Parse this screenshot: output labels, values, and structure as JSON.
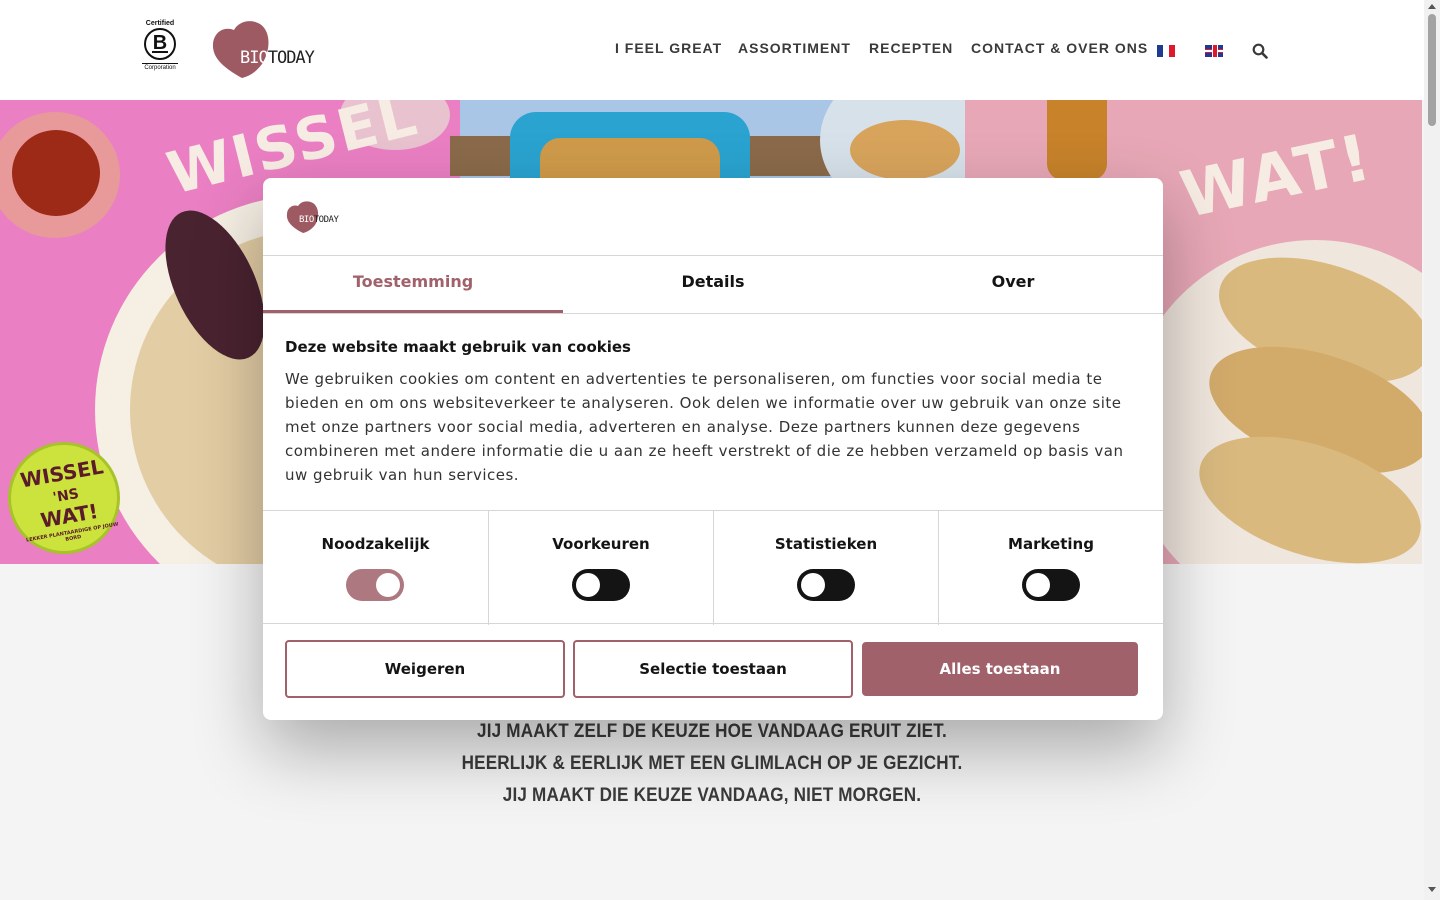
{
  "header": {
    "certified_logo": {
      "top": "Certified",
      "letter": "B",
      "bottom": "Corporation"
    },
    "brand_logo": {
      "part1": "BIO",
      "part2": "TODAY"
    },
    "nav": [
      {
        "label": "I FEEL GREAT"
      },
      {
        "label": "ASSORTIMENT"
      },
      {
        "label": "RECEPTEN"
      },
      {
        "label": "CONTACT & OVER ONS"
      }
    ],
    "languages": [
      {
        "name": "flag-fr-icon"
      },
      {
        "name": "flag-uk-icon"
      }
    ],
    "search_icon": "search-icon"
  },
  "hero": {
    "left_word": "WISSEL",
    "right_word": "WAT!",
    "badge": {
      "line1": "WISSEL",
      "line2": "'NS",
      "line3": "WAT!",
      "sub": "LEKKER PLANTAARDIGE OP JOUW BORD"
    }
  },
  "tagline": [
    "JIJ MAAKT ZELF DE KEUZE HOE VANDAAG ERUIT ZIET.",
    "HEERLIJK & EERLIJK MET EEN GLIMLACH OP JE GEZICHT.",
    "JIJ MAAKT DIE KEUZE VANDAAG, NIET MORGEN."
  ],
  "cookie_dialog": {
    "logo": {
      "part1": "BIO",
      "part2": "TODAY"
    },
    "tabs": [
      {
        "label": "Toestemming",
        "active": true
      },
      {
        "label": "Details",
        "active": false
      },
      {
        "label": "Over",
        "active": false
      }
    ],
    "title": "Deze website maakt gebruik van cookies",
    "body": "We gebruiken cookies om content en advertenties te personaliseren, om functies voor social media te bieden en om ons websiteverkeer te analyseren. Ook delen we informatie over uw gebruik van onze site met onze partners voor social media, adverteren en analyse. Deze partners kunnen deze gegevens combineren met andere informatie die u aan ze heeft verstrekt of die ze hebben verzameld op basis van uw gebruik van hun services.",
    "toggles": [
      {
        "label": "Noodzakelijk",
        "checked": true
      },
      {
        "label": "Voorkeuren",
        "checked": false
      },
      {
        "label": "Statistieken",
        "checked": false
      },
      {
        "label": "Marketing",
        "checked": false
      }
    ],
    "buttons": {
      "reject": "Weigeren",
      "allow_selection": "Selectie toestaan",
      "allow_all": "Alles toestaan"
    },
    "accent_color": "#a0616a"
  }
}
